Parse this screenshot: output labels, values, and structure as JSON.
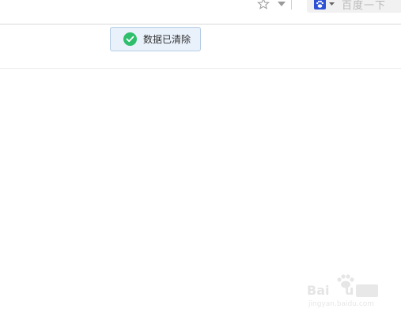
{
  "toolbar": {
    "star_icon": "star-outline-icon",
    "dropdown_icon": "caret-down-icon",
    "search": {
      "engine_icon": "baidu-paw-icon",
      "placeholder": "百度一下"
    }
  },
  "toast": {
    "icon": "check-circle-icon",
    "message": "数据已清除",
    "accent_color": "#2fbf6c",
    "background_color": "#e9f1fb"
  },
  "watermark": {
    "logo_text": "Baidu经验",
    "url_text": "jingyan.baidu.com"
  }
}
